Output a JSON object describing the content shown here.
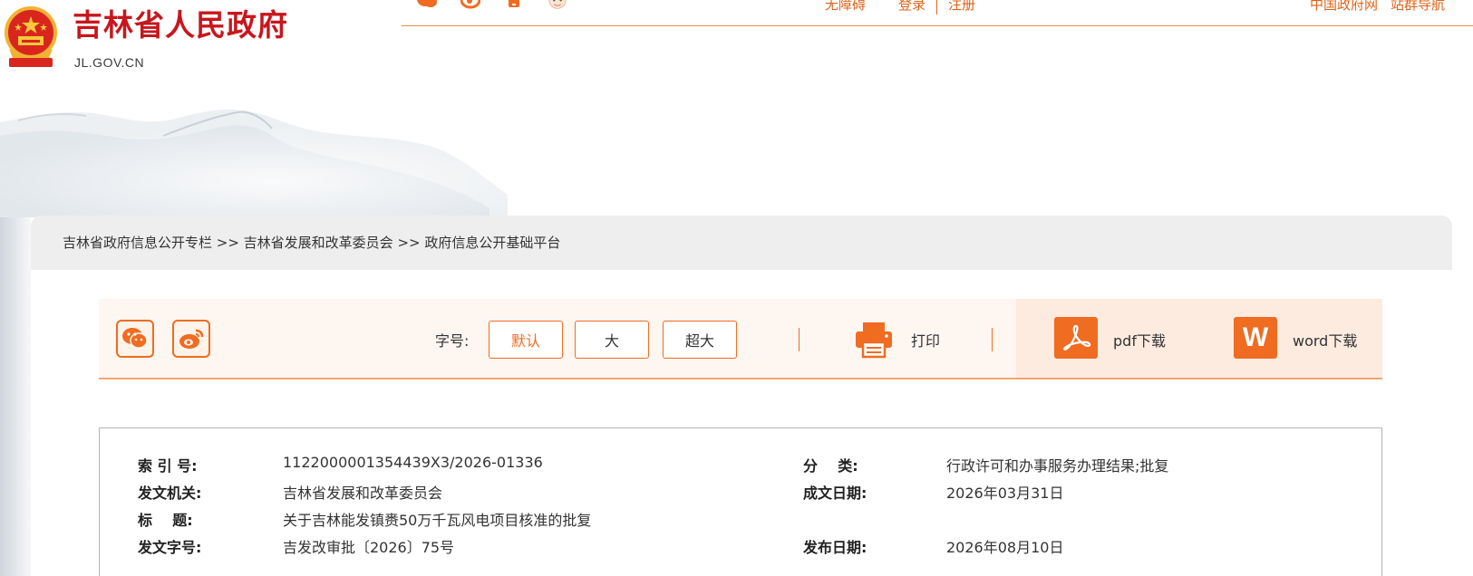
{
  "header": {
    "site_title": "吉林省人民政府",
    "site_domain": "JL.GOV.CN",
    "top_icons": [
      "weibo-icon",
      "weibo-icon",
      "mobile-icon",
      "elderly-icon"
    ],
    "accessibility_link": "无障碍",
    "login_link": "登录",
    "register_link": "注册",
    "gov_link": "中国政府网",
    "sitemap_link": "站群导航"
  },
  "breadcrumb": {
    "text": "吉林省政府信息公开专栏 >> 吉林省发展和改革委员会 >> 政府信息公开基础平台"
  },
  "toolbar": {
    "font_size_label": "字号:",
    "font_sizes": [
      "默认",
      "大",
      "超大"
    ],
    "active_font_size": "默认",
    "print_label": "打印",
    "pdf_label": "pdf下载",
    "word_label": "word下载",
    "word_icon_letter": "W"
  },
  "info": {
    "index_no_label": "索 引 号:",
    "index_no": "1122000001354439X3/2026-01336",
    "category_label": "分    类:",
    "category": "行政许可和办事服务办理结果;批复",
    "issuer_label": "发文机关:",
    "issuer": "吉林省发展和改革委员会",
    "created_date_label": "成文日期:",
    "created_date": "2026年03月31日",
    "title_label": "标    题:",
    "title": "关于吉林能发镇赉50万千瓦风电项目核准的批复",
    "doc_no_label": "发文字号:",
    "doc_no": "吉发改审批〔2026〕75号",
    "publish_date_label": "发布日期:",
    "publish_date": "2026年08月10日"
  },
  "colors": {
    "accent": "#ef6c21",
    "title_red": "#c8161d",
    "link_orange": "#e06318",
    "toolbar_bg": "#fef6f1"
  }
}
